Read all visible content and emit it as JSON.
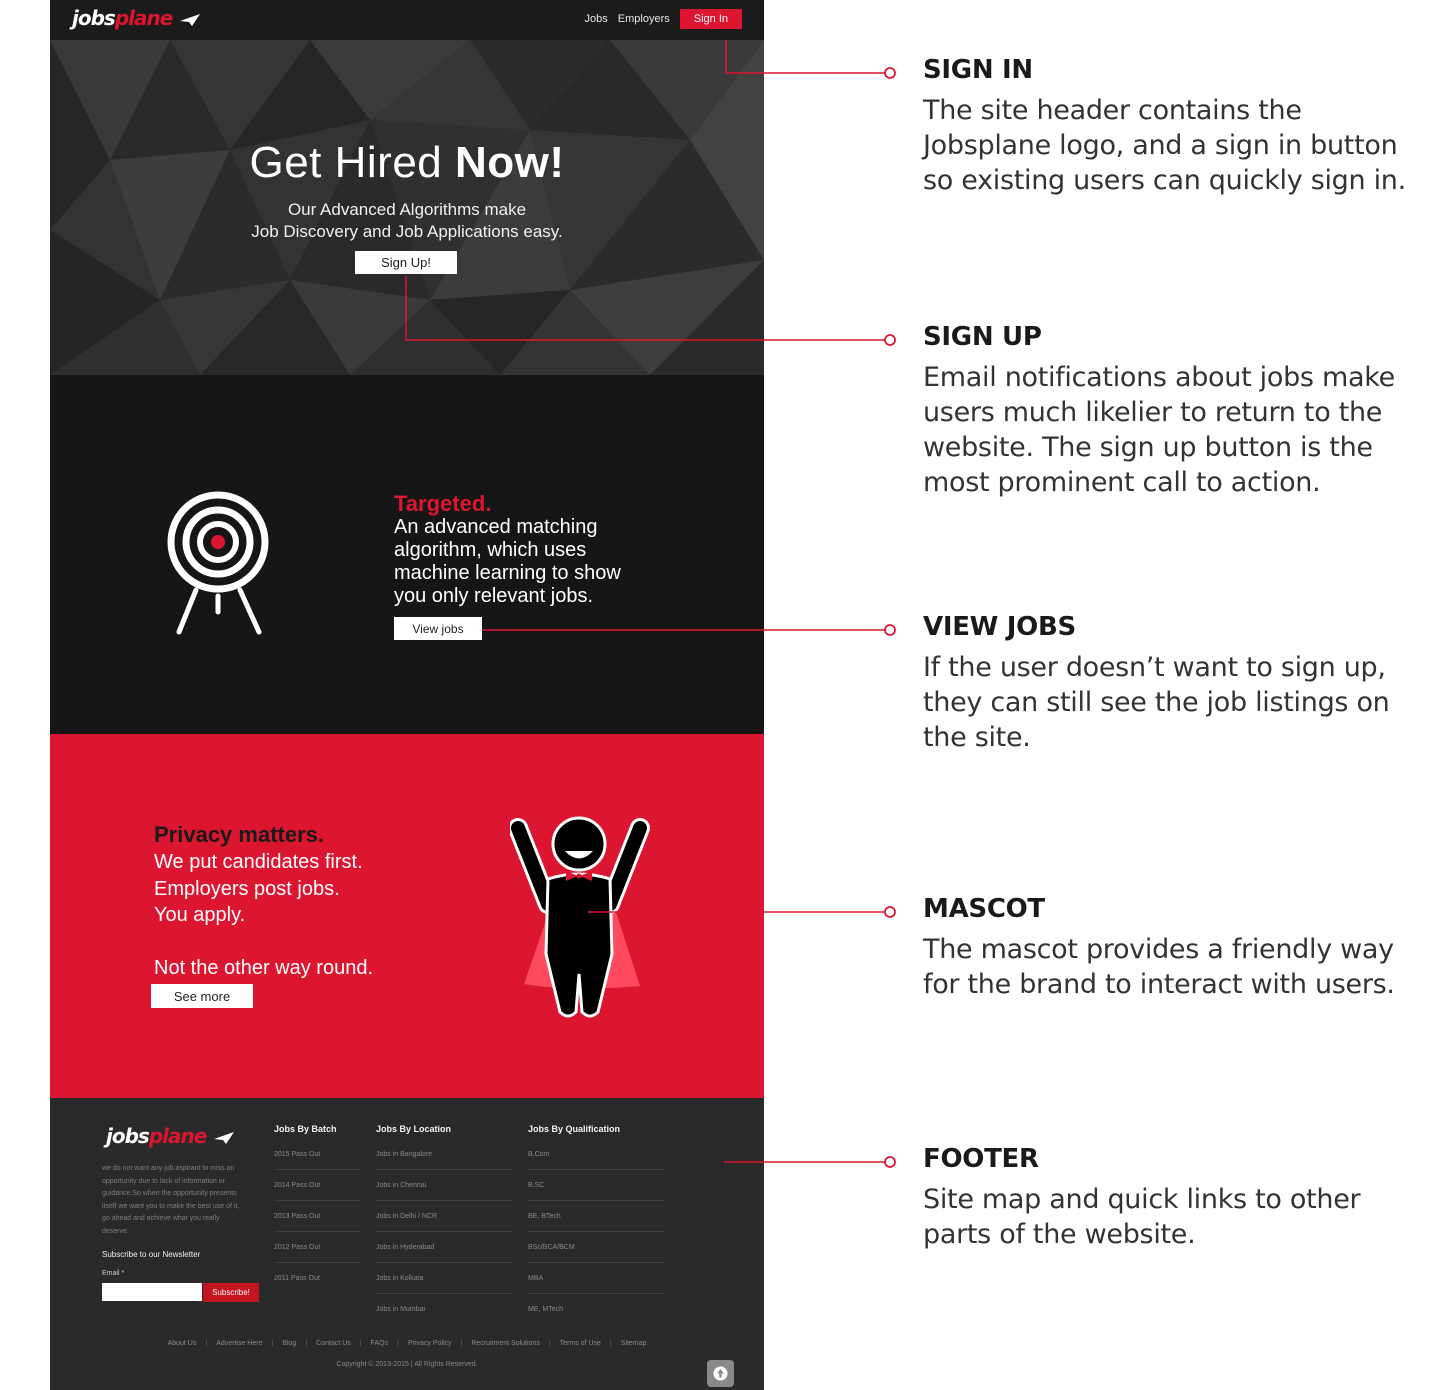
{
  "colors": {
    "brand_red": "#dc1530",
    "dark": "#161616",
    "footer": "#2a2a2a",
    "white": "#ffffff"
  },
  "site": {
    "header": {
      "logo": {
        "word1": "jobs",
        "word2": "plane"
      },
      "nav": {
        "jobs": "Jobs",
        "employers": "Employers",
        "sign_in": "Sign In"
      }
    },
    "hero": {
      "title_light": "Get Hired ",
      "title_bold": "Now!",
      "sub_line1": "Our Advanced Algorithms make",
      "sub_line2": "Job Discovery and Job Applications easy.",
      "cta": "Sign Up!"
    },
    "targeted": {
      "icon": "target-icon",
      "heading": "Targeted.",
      "lines": [
        "An advanced matching",
        "algorithm, which uses",
        "machine learning to show",
        "you only relevant jobs."
      ],
      "cta": "View jobs"
    },
    "privacy": {
      "icon": "mascot-icon",
      "heading": "Privacy matters.",
      "lines": [
        "We put candidates first.",
        "Employers post jobs.",
        "You apply.",
        "",
        "Not the other way round."
      ],
      "cta": "See more"
    },
    "footer": {
      "description_lines": [
        "we do not want any job aspirant to miss an",
        "opportunity due to lack of information or",
        "guidance.So when the opportunity presents",
        "itself we want you to make the best use of it,",
        "go ahead and achieve what you really",
        "deserve."
      ],
      "newsletter_title": "Subscribe to our Newsletter",
      "email_label": "Email *",
      "subscribe": "Subscribe!",
      "columns": [
        {
          "title": "Jobs By Batch",
          "links": [
            "2015 Pass Out",
            "2014 Pass Out",
            "2013 Pass Out",
            "2012 Pass Out",
            "2011 Pass Out"
          ]
        },
        {
          "title": "Jobs By Location",
          "links": [
            "Jobs in Bangalore",
            "Jobs in Chennai",
            "Jobs in Delhi / NCR",
            "Jobs in Hyderabad",
            "Jobs in Kolkata",
            "Jobs in Mumbai"
          ]
        },
        {
          "title": "Jobs By Qualification",
          "links": [
            "B.Com",
            "B.SC",
            "BE, BTech",
            "BSc/BCA/BCM",
            "MBA",
            "ME, MTech"
          ]
        }
      ],
      "bottom_links": [
        "About Us",
        "Advertise Here",
        "Blog",
        "Contact Us",
        "FAQs",
        "Privacy Policy",
        "Recruitment Solutions",
        "Terms of Use",
        "Sitemap"
      ],
      "copyright": "Copyright © 2013-2015 | All Rights Reserved.",
      "to_top_icon": "arrow-up-icon"
    }
  },
  "annotations": [
    {
      "title": "SIGN IN",
      "lines": [
        "The site header contains the",
        "Jobsplane logo, and a sign in button",
        "so existing users can quickly sign in."
      ]
    },
    {
      "title": "SIGN UP",
      "lines": [
        "Email notifications about jobs make",
        "users much likelier to return to the",
        "website. The sign up button is the",
        "most prominent call to action."
      ]
    },
    {
      "title": "VIEW JOBS",
      "lines": [
        "If the user doesn’t want to sign up,",
        "they can still see the job listings on",
        "the site."
      ]
    },
    {
      "title": "MASCOT",
      "lines": [
        "The mascot provides a friendly way",
        "for the brand to interact with users."
      ]
    },
    {
      "title": "FOOTER",
      "lines": [
        "Site map and quick links to other",
        "parts of the website."
      ]
    }
  ]
}
